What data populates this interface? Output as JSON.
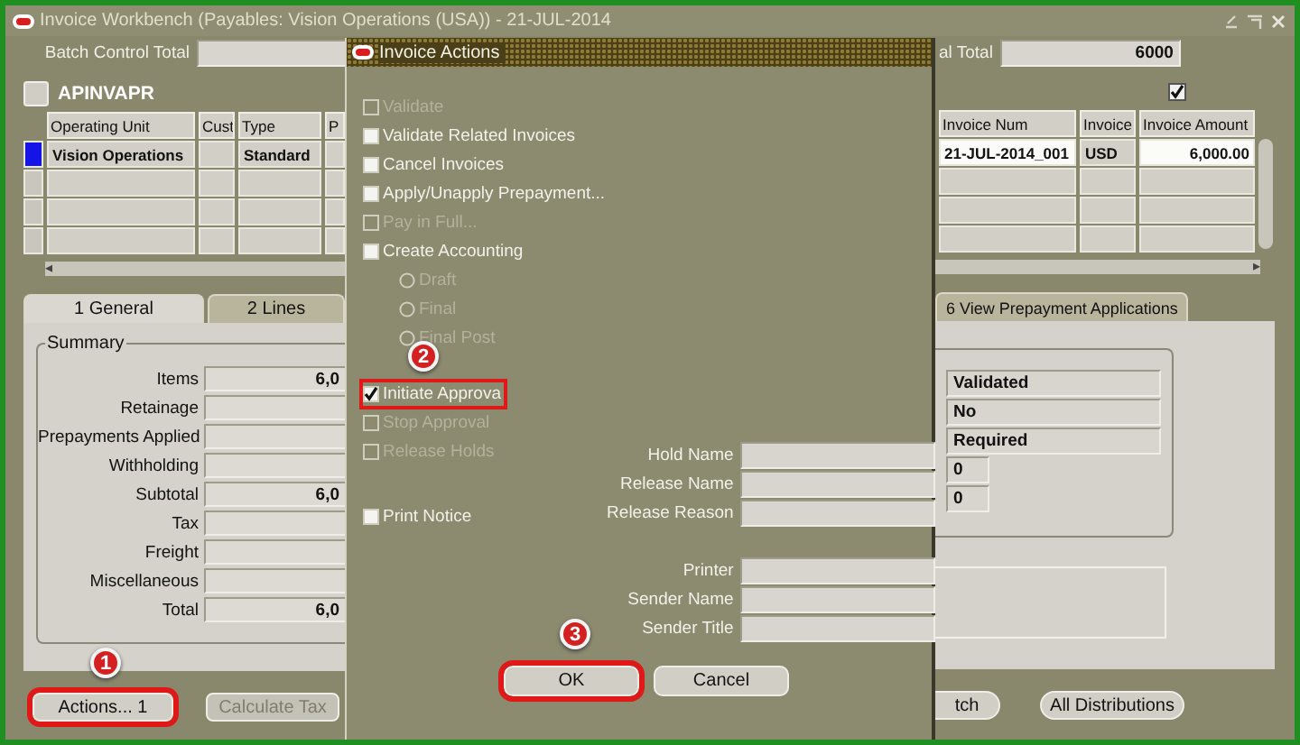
{
  "window": {
    "title": "Invoice Workbench (Payables: Vision Operations (USA)) - 21-JUL-2014"
  },
  "header": {
    "batch_label": "Batch Control Total",
    "right_label": "al Total",
    "right_value": "6000",
    "form_code": "APINVAPR",
    "checked": true
  },
  "scroll_arrows": [
    "◂",
    "▸"
  ],
  "table": {
    "left_columns": [
      "Operating Unit",
      "Cust",
      "Type",
      "P"
    ],
    "right_columns": [
      "Invoice Num",
      "Invoice",
      "Invoice Amount"
    ],
    "rows": [
      {
        "current": true,
        "operating_unit": "Vision Operations",
        "type": "Standard",
        "invoice_num": "21-JUL-2014_001",
        "currency": "USD",
        "amount": "6,000.00"
      }
    ]
  },
  "left_tabs": [
    {
      "label": "1 General",
      "selected": true
    },
    {
      "label": "2 Lines",
      "selected": false
    }
  ],
  "right_tabs": [
    {
      "label": "6 View Prepayment Applications",
      "selected": false
    }
  ],
  "summary": {
    "title": "Summary",
    "rows": [
      {
        "label": "Items",
        "value": "6,0"
      },
      {
        "label": "Retainage"
      },
      {
        "label": "Prepayments Applied"
      },
      {
        "label": "Withholding"
      },
      {
        "label": "Subtotal",
        "value": "6,0"
      },
      {
        "label": "Tax"
      },
      {
        "label": "Freight"
      },
      {
        "label": "Miscellaneous"
      },
      {
        "label": "Total",
        "value": "6,0"
      }
    ]
  },
  "status_fields": [
    {
      "kind": "wide",
      "value": "Validated"
    },
    {
      "kind": "wide",
      "value": "No"
    },
    {
      "kind": "wide",
      "value": "Required"
    },
    {
      "kind": "narrow",
      "value": "0"
    },
    {
      "kind": "narrow",
      "value": "0"
    }
  ],
  "left_buttons": [
    {
      "label": "Actions... 1",
      "disabled": false,
      "highlighted": true,
      "step": "1"
    },
    {
      "label": "Calculate Tax",
      "disabled": true,
      "highlighted": false
    }
  ],
  "right_buttons": [
    {
      "label": "tch",
      "disabled": false,
      "highlighted": false
    },
    {
      "label": "All Distributions",
      "disabled": false,
      "highlighted": false
    }
  ],
  "dialog": {
    "title": "Invoice Actions",
    "option_groups": [
      [
        {
          "kind": "checkbox",
          "label": "Validate",
          "checked": false,
          "disabled": true
        },
        {
          "kind": "checkbox",
          "label": "Validate Related Invoices",
          "checked": false,
          "disabled": false
        },
        {
          "kind": "checkbox",
          "label": "Cancel Invoices",
          "checked": false,
          "disabled": false
        },
        {
          "kind": "checkbox",
          "label": "Apply/Unapply Prepayment...",
          "checked": false,
          "disabled": false
        },
        {
          "kind": "checkbox",
          "label": "Pay in Full...",
          "checked": false,
          "disabled": true
        },
        {
          "kind": "checkbox",
          "label": "Create Accounting",
          "checked": false,
          "disabled": false
        },
        {
          "kind": "radio",
          "label": "Draft",
          "checked": false,
          "disabled": true
        },
        {
          "kind": "radio",
          "label": "Final",
          "checked": false,
          "disabled": true
        },
        {
          "kind": "radio",
          "label": "Final Post",
          "checked": false,
          "disabled": true
        }
      ],
      [
        {
          "kind": "checkbox",
          "label": "Initiate Approva",
          "checked": true,
          "disabled": false,
          "highlighted": true,
          "step": "2"
        },
        {
          "kind": "checkbox",
          "label": "Stop Approval",
          "checked": false,
          "disabled": true
        },
        {
          "kind": "checkbox",
          "label": "Release Holds",
          "checked": false,
          "disabled": true
        }
      ],
      [
        {
          "kind": "checkbox",
          "label": "Print Notice",
          "checked": false,
          "disabled": false
        }
      ]
    ],
    "field_groups": [
      [
        "Hold Name",
        "Release Name",
        "Release Reason"
      ],
      [
        "Printer",
        "Sender Name",
        "Sender Title"
      ]
    ],
    "buttons": [
      {
        "label": "OK",
        "highlighted": true,
        "step": "3"
      },
      {
        "label": "Cancel",
        "highlighted": false
      }
    ]
  }
}
